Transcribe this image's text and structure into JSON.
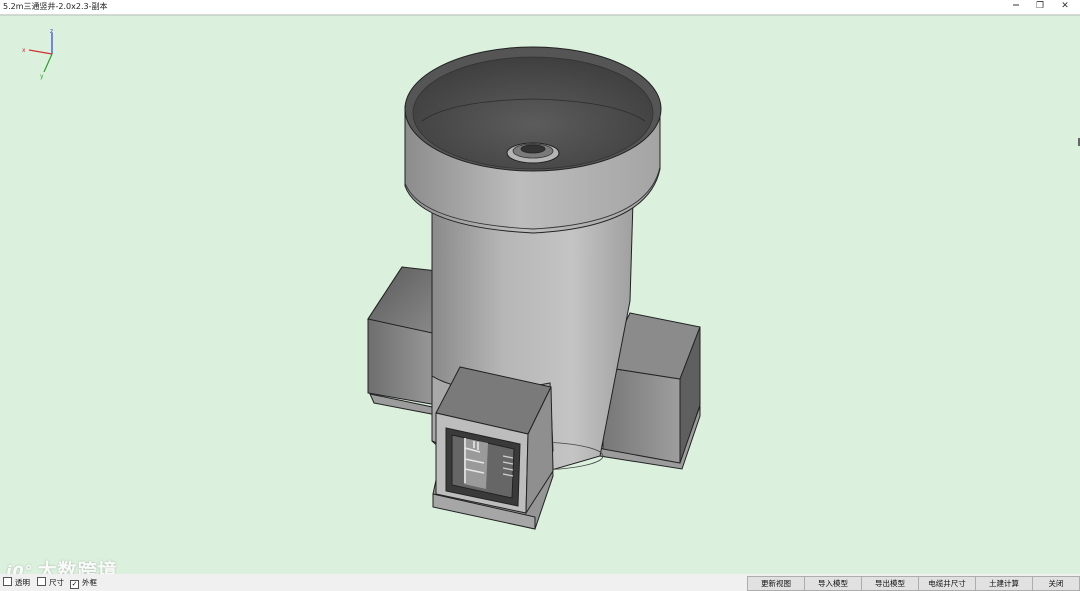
{
  "window": {
    "title": "5.2m三通竖井-2.0x2.3-副本",
    "restore_glyph": "❐",
    "close_glyph": "✕"
  },
  "viewport": {
    "background_color": "#dbf1dd",
    "axis_labels": {
      "x": "x",
      "y": "y",
      "z": "z"
    },
    "axis_colors": {
      "x": "#d03030",
      "y": "#2ca02c",
      "z": "#2b3fd0"
    }
  },
  "watermark": {
    "logo": "i0°",
    "text": "大数跨境"
  },
  "options": {
    "transparent": {
      "label": "透明",
      "checked": false
    },
    "dimension": {
      "label": "尺寸",
      "checked": false
    },
    "wireframe": {
      "label": "外框",
      "checked": true
    }
  },
  "buttons": {
    "update_view": "更新视图",
    "import_model": "导入模型",
    "export_model": "导出模型",
    "cable_well_size": "电缆井尺寸",
    "civil_calc": "土建计算",
    "close": "关闭"
  }
}
